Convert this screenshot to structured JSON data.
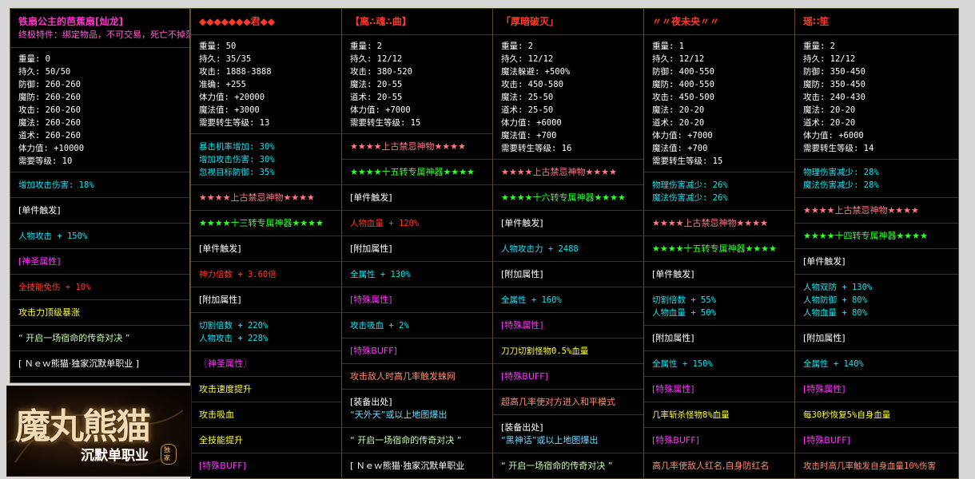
{
  "panels": [
    {
      "title": {
        "text": "铁扇公主的芭蕉扇[灿龙]",
        "color": "c-title"
      },
      "subtitle": {
        "text": "终极特件：绑定物品，不可交易，死亡不掉落",
        "color": "c-bright"
      },
      "stats": [
        "重量: 0",
        "持久: 50/50",
        "防御: 260-260",
        "魔防: 260-260",
        "攻击: 260-260",
        "魔法: 260-260",
        "道术: 260-260",
        "体力值: +10000",
        "需要等级: 10"
      ],
      "rows": [
        {
          "lines": [
            "增加攻击伤害: 18%"
          ],
          "color": "c-cyan"
        },
        {
          "lines": [
            "[单件触发]"
          ],
          "color": "c-white"
        },
        {
          "lines": [
            "人物攻击 + 150%"
          ],
          "color": "c-cyan"
        },
        {
          "lines": [
            "[神圣属性]"
          ],
          "color": "c-magenta"
        },
        {
          "lines": [
            "全技能免伤 + 10%"
          ],
          "color": "c-red"
        },
        {
          "lines": [
            "攻击力顶级暴涨"
          ],
          "color": "c-yellow"
        },
        {
          "lines": [
            "“  开启一场宿命的传奇对决  ”"
          ],
          "color": "c-lgreen"
        },
        {
          "lines": [
            "[  Ｎｅｗ熊猫·独家沉默单职业  ]"
          ],
          "color": "c-white"
        }
      ]
    },
    {
      "title": {
        "text": "◆◆◆◆◆◆◆君◆◆",
        "color": "c-red"
      },
      "stats": [
        "重量: 50",
        "持久: 35/35",
        "攻击: 1888-3888",
        "准确: +255",
        "体力值: +20000",
        "魔法值: +3000",
        "需要转生等级: 13"
      ],
      "rows": [
        {
          "lines": [
            "暴击机率增加: 30%",
            "增加攻击伤害: 30%",
            "忽视目标防御: 35%"
          ],
          "color": "c-cyan"
        },
        {
          "lines": [
            "★★★★上古禁忌神物★★★★"
          ],
          "color": "c-pink"
        },
        {
          "lines": [
            "★★★★十三转专属神器★★★★"
          ],
          "color": "c-green"
        },
        {
          "lines": [
            "[单件触发]"
          ],
          "color": "c-white"
        },
        {
          "lines": [
            "神力倍数 + 3.60倍"
          ],
          "color": "c-red"
        },
        {
          "lines": [
            "[附加属性]"
          ],
          "color": "c-white"
        },
        {
          "lines": [
            "切割倍数 + 220%",
            "人物攻击 + 228%"
          ],
          "color": "c-cyan"
        },
        {
          "lines": [
            "〖神圣属性〗"
          ],
          "color": "c-magenta"
        },
        {
          "lines": [
            "攻击速度提升"
          ],
          "color": "c-yellow"
        },
        {
          "lines": [
            "攻击吸血"
          ],
          "color": "c-yellow"
        },
        {
          "lines": [
            "全技能提升"
          ],
          "color": "c-yellow"
        },
        {
          "lines": [
            "[特殊BUFF]"
          ],
          "color": "c-magenta"
        }
      ]
    },
    {
      "title": {
        "text": "【离∴魂∴曲】",
        "color": "c-red"
      },
      "stats": [
        "重量: 2",
        "持久: 12/12",
        "攻击: 380-520",
        "魔法: 20-55",
        "道术: 20-55",
        "体力值: +7000",
        "需要转生等级: 15"
      ],
      "rows": [
        {
          "lines": [
            "★★★★上古禁忌神物★★★★"
          ],
          "color": "c-pink"
        },
        {
          "lines": [
            "★★★★十五转专属神器★★★★"
          ],
          "color": "c-green"
        },
        {
          "lines": [
            "[单件触发]"
          ],
          "color": "c-white"
        },
        {
          "lines": [
            "人物血量 + 120%"
          ],
          "color": "c-red"
        },
        {
          "lines": [
            "[附加属性]"
          ],
          "color": "c-white"
        },
        {
          "lines": [
            "全属性 + 130%"
          ],
          "color": "c-cyan"
        },
        {
          "lines": [
            "[特殊属性]"
          ],
          "color": "c-magenta"
        },
        {
          "lines": [
            "攻击吸血 + 2%"
          ],
          "color": "c-cyan"
        },
        {
          "lines": [
            "[特殊BUFF]"
          ],
          "color": "c-magenta"
        },
        {
          "lines": [
            "攻击敌人时高几率触发蛛网"
          ],
          "color": "c-lred"
        },
        {
          "lines": [
            "[装备出处]",
            "“天外天”或以上地图爆出"
          ],
          "color": "c-white",
          "second": "c-ltblue"
        },
        {
          "lines": [
            "“  开启一场宿命的传奇对决  ”"
          ],
          "color": "c-lgreen"
        },
        {
          "lines": [
            "[  Ｎｅｗ熊猫·独家沉默单职业"
          ],
          "color": "c-white"
        }
      ]
    },
    {
      "title": {
        "text": "「厚暗破灭」",
        "color": "c-red"
      },
      "stats": [
        "重量: 2",
        "持久: 12/12",
        "魔法躲避: +500%",
        "攻击: 450-580",
        "魔法: 25-50",
        "道术: 25-50",
        "体力值: +6000",
        "魔法值: +700",
        "需要转生等级: 16"
      ],
      "rows": [
        {
          "lines": [
            "★★★★上古禁忌神物★★★★"
          ],
          "color": "c-pink"
        },
        {
          "lines": [
            "★★★★十六转专属神器★★★★"
          ],
          "color": "c-green"
        },
        {
          "lines": [
            "[单件触发]"
          ],
          "color": "c-white"
        },
        {
          "lines": [
            "人物攻击力 + 2488"
          ],
          "color": "c-cyan"
        },
        {
          "lines": [
            "[附加属性]"
          ],
          "color": "c-white"
        },
        {
          "lines": [
            "全属性 + 160%"
          ],
          "color": "c-cyan"
        },
        {
          "lines": [
            "[特殊属性]"
          ],
          "color": "c-magenta"
        },
        {
          "lines": [
            "刀刀切割怪物0.5%血量"
          ],
          "color": "c-yellow"
        },
        {
          "lines": [
            "[特殊BUFF]"
          ],
          "color": "c-magenta"
        },
        {
          "lines": [
            "超高几率使对方进入和平模式"
          ],
          "color": "c-lred"
        },
        {
          "lines": [
            "[装备出处]",
            "“黑神话”或以上地图爆出"
          ],
          "color": "c-white",
          "second": "c-ltblue"
        },
        {
          "lines": [
            "“  开启一场宿命的传奇对决  ”"
          ],
          "color": "c-lgreen"
        }
      ]
    },
    {
      "title": {
        "text": "〃〃夜未央〃〃",
        "color": "c-red"
      },
      "stats": [
        "重量: 1",
        "持久: 12/12",
        "防御: 400-550",
        "魔防: 400-550",
        "攻击: 450-500",
        "魔法: 20-20",
        "道术: 20-20",
        "体力值: +7000",
        "魔法值: +700",
        "需要转生等级: 15"
      ],
      "rows": [
        {
          "lines": [
            "物理伤害减少: 26%",
            "魔法伤害减少: 26%"
          ],
          "color": "c-cyan"
        },
        {
          "lines": [
            "★★★★上古禁忌神物★★★★"
          ],
          "color": "c-pink"
        },
        {
          "lines": [
            "★★★★十五转专属神器★★★★"
          ],
          "color": "c-green"
        },
        {
          "lines": [
            "[单件触发]"
          ],
          "color": "c-white"
        },
        {
          "lines": [
            "切割倍数 + 55%",
            "人物血量 + 50%"
          ],
          "color": "c-cyan"
        },
        {
          "lines": [
            "[附加属性]"
          ],
          "color": "c-white"
        },
        {
          "lines": [
            "全属性 + 150%"
          ],
          "color": "c-cyan"
        },
        {
          "lines": [
            "[特殊属性]"
          ],
          "color": "c-magenta"
        },
        {
          "lines": [
            "几率斩杀怪物8%血量"
          ],
          "color": "c-yellow"
        },
        {
          "lines": [
            "[特殊BUFF]"
          ],
          "color": "c-magenta"
        },
        {
          "lines": [
            "高几率使敌人红名,自身防红名"
          ],
          "color": "c-lred"
        }
      ]
    },
    {
      "title": {
        "text": "瑶∷笙",
        "color": "c-red"
      },
      "stats": [
        "重量: 2",
        "持久: 12/12",
        "防御: 350-450",
        "魔防: 350-450",
        "攻击: 240-430",
        "魔法: 20-20",
        "道术: 20-20",
        "体力值: +6000",
        "需要转生等级: 14"
      ],
      "rows": [
        {
          "lines": [
            "物理伤害减少: 28%",
            "魔法伤害减少: 28%"
          ],
          "color": "c-cyan"
        },
        {
          "lines": [
            "★★★★上古禁忌神物★★★★"
          ],
          "color": "c-pink"
        },
        {
          "lines": [
            "★★★★十四转专属神器★★★★"
          ],
          "color": "c-green"
        },
        {
          "lines": [
            "[单件触发]"
          ],
          "color": "c-white"
        },
        {
          "lines": [
            "人物双防 + 130%",
            "人物防御 + 80%",
            "人物血量 + 80%"
          ],
          "color": "c-cyan"
        },
        {
          "lines": [
            "[附加属性]"
          ],
          "color": "c-white"
        },
        {
          "lines": [
            "全属性 + 140%"
          ],
          "color": "c-cyan"
        },
        {
          "lines": [
            "[特殊属性]"
          ],
          "color": "c-magenta"
        },
        {
          "lines": [
            "每30秒恢复5%自身血量"
          ],
          "color": "c-yellow"
        },
        {
          "lines": [
            "[特殊BUFF]"
          ],
          "color": "c-magenta"
        },
        {
          "lines": [
            "攻击时高几率触发自身血量10%伤害"
          ],
          "color": "c-lred"
        }
      ]
    }
  ],
  "logo": {
    "main": "魔丸熊猫",
    "sub": "沉默单职业",
    "badge": "独家"
  }
}
